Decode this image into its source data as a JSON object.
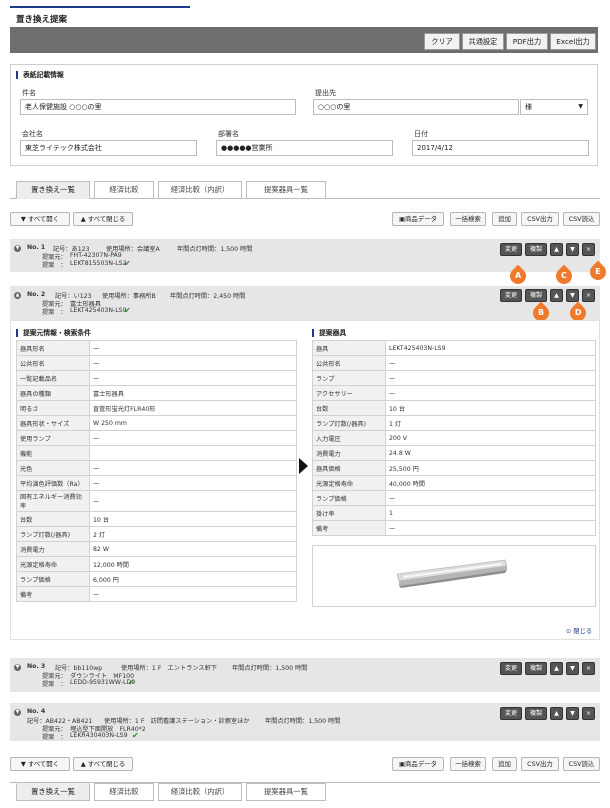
{
  "page_title": "置き換え提案",
  "toolbar": {
    "clear": "クリア",
    "common": "共通設定",
    "pdf": "PDF出力",
    "excel": "Excel出力"
  },
  "form": {
    "section_title": "表紙記載情報",
    "subject_label": "件名",
    "subject_value": "老人保健施設 ○○○の里",
    "submit_label": "提出先",
    "submit_value": "○○○の里",
    "honorific": "様",
    "company_label": "会社名",
    "company_value": "東芝ライテック株式会社",
    "dept_label": "部署名",
    "dept_value": "●●●●●営業所",
    "date_label": "日付",
    "date_value": "2017/4/12"
  },
  "tabs": [
    "置き換え一覧",
    "経済比較",
    "経済比較（内訳）",
    "提案器具一覧"
  ],
  "actions": {
    "open_all": "すべて開く",
    "close_all": "すべて閉じる",
    "product_data": "商品データ",
    "bulk_search": "一括検索",
    "add": "追加",
    "csv_out": "CSV出力",
    "csv_in": "CSV読込"
  },
  "item_buttons": {
    "change": "変更",
    "copy": "複製",
    "up": "▲",
    "down": "▼",
    "delete": "×"
  },
  "items": [
    {
      "no": "No. 1",
      "symbol": "記号：あ123",
      "place": "使用場所：会議室A",
      "hours": "年間点灯時間：1,500 時間",
      "orig_label": "提案元：",
      "orig": "FHT-42307N-PA9",
      "prop_label": "提案　：",
      "prop": "LEKT815503N-LS2"
    },
    {
      "no": "No. 2",
      "symbol": "記号：い123",
      "place": "使用場所：事務所B",
      "hours": "年間点灯時間：2,450 時間",
      "orig_label": "提案元：",
      "orig": "富士形器具",
      "prop_label": "提案　：",
      "prop": "LEKT425403N-LS9"
    },
    {
      "no": "No. 3",
      "symbol": "記号：bb110wp",
      "place": "使用場所：1 F　エントランス軒下",
      "hours": "年間点灯時間：1,500 時間",
      "orig_label": "提案元：",
      "orig": "ダウンライト　MF100",
      "prop_label": "提案　：",
      "prop": "LEDD-95931WW-LD9"
    },
    {
      "no": "No. 4",
      "symbol": "記号：AB422・AB421",
      "place": "使用場所：1 F　訪問看護ステーション・診察室ほか",
      "hours": "年間点灯時間：1,500 時間",
      "orig_label": "提案元：",
      "orig": "埋込型下面開放　FLR40*2",
      "prop_label": "提案　：",
      "prop": "LEKR430403N-LS9"
    }
  ],
  "markers": [
    "A",
    "B",
    "C",
    "D",
    "E"
  ],
  "left_section": {
    "title": "提案元情報・検索条件",
    "rows": [
      [
        "器具形名",
        "ー"
      ],
      [
        "公共形名",
        "ー"
      ],
      [
        "一覧記載品名",
        "ー"
      ],
      [
        "器具の種類",
        "富士形器具"
      ],
      [
        "明るさ",
        "直管形蛍光灯FLR40形"
      ],
      [
        "器具形状・サイズ",
        "W 250 mm"
      ],
      [
        "使用ランプ",
        "ー"
      ],
      [
        "機能",
        ""
      ],
      [
        "光色",
        "ー"
      ],
      [
        "平均演色評価数（Ra）",
        "ー"
      ],
      [
        "固有エネルギー消費効率",
        "ー"
      ],
      [
        "台数",
        "10 台"
      ],
      [
        "ランプ灯数(/器具)",
        "2 灯"
      ],
      [
        "消費電力",
        "82 W"
      ],
      [
        "光源定格寿命",
        "12,000 時間"
      ],
      [
        "ランプ価格",
        "6,000 円"
      ],
      [
        "備考",
        "ー"
      ]
    ]
  },
  "right_section": {
    "title": "提案器具",
    "rows": [
      [
        "器具",
        "LEKT425403N-LS9"
      ],
      [
        "公共形名",
        "ー"
      ],
      [
        "ランプ",
        "ー"
      ],
      [
        "アクセサリー",
        "ー"
      ],
      [
        "台数",
        "10 台"
      ],
      [
        "ランプ灯数(/器具)",
        "1 灯"
      ],
      [
        "入力電圧",
        "200 V"
      ],
      [
        "消費電力",
        "24.8 W"
      ],
      [
        "器具価格",
        "25,500 円"
      ],
      [
        "光源定格寿命",
        "40,000 時間"
      ],
      [
        "ランプ価格",
        "ー"
      ],
      [
        "掛け率",
        "1"
      ],
      [
        "備考",
        "ー"
      ]
    ],
    "close_label": "閉じる"
  }
}
